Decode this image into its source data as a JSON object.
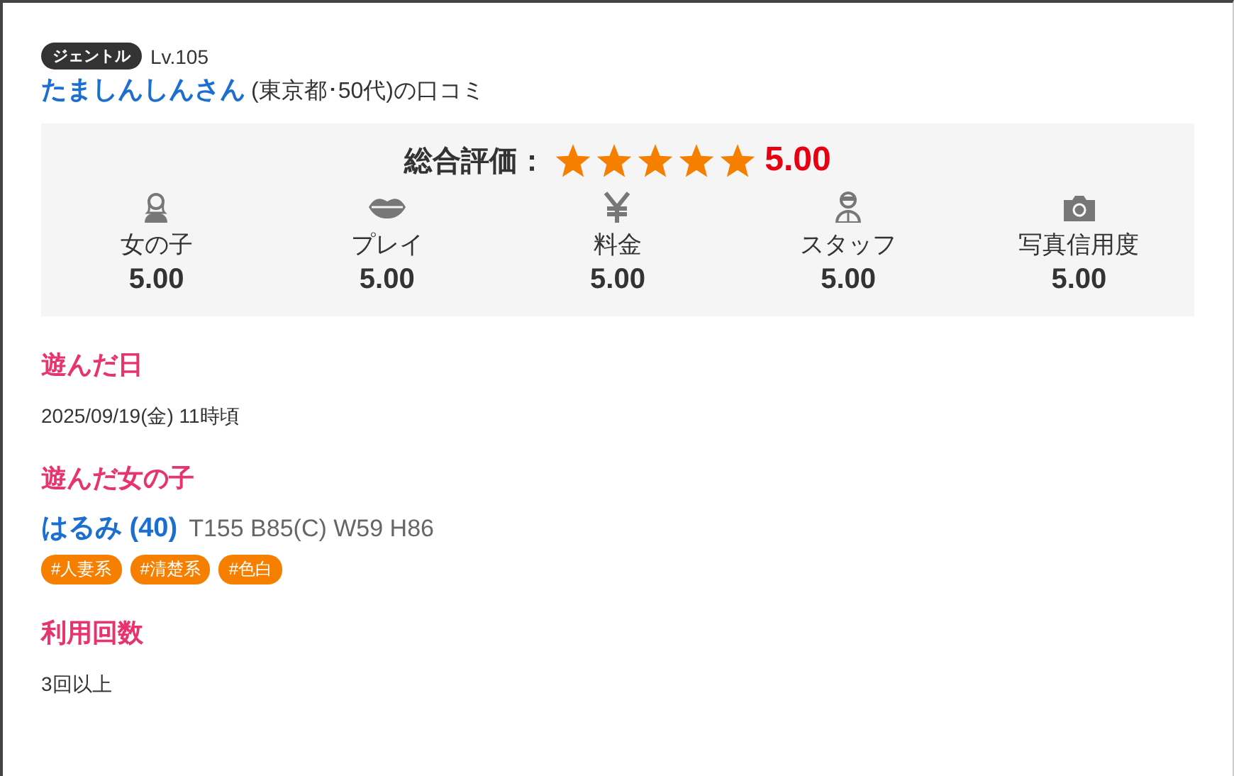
{
  "reviewer": {
    "rank": "ジェントル",
    "level": "Lv.105",
    "name": "たましんしんさん",
    "info": "(東京都･50代)の口コミ"
  },
  "rating": {
    "label": "総合評価：",
    "stars": 5,
    "score": "5.00",
    "categories": [
      {
        "kind": "girl",
        "label": "女の子",
        "score": "5.00"
      },
      {
        "kind": "lips",
        "label": "プレイ",
        "score": "5.00"
      },
      {
        "kind": "yen",
        "label": "料金",
        "score": "5.00"
      },
      {
        "kind": "staff",
        "label": "スタッフ",
        "score": "5.00"
      },
      {
        "kind": "camera",
        "label": "写真信用度",
        "score": "5.00"
      }
    ]
  },
  "sections": [
    {
      "kind": "text",
      "heading": "遊んだ日",
      "text": "2025/09/19(金) 11時頃"
    },
    {
      "kind": "girl",
      "heading": "遊んだ女の子",
      "name": "はるみ (40)",
      "stats": "T155 B85(C) W59 H86",
      "tags": [
        "#人妻系",
        "#清楚系",
        "#色白"
      ]
    },
    {
      "kind": "text",
      "heading": "利用回数",
      "text": "3回以上"
    }
  ]
}
